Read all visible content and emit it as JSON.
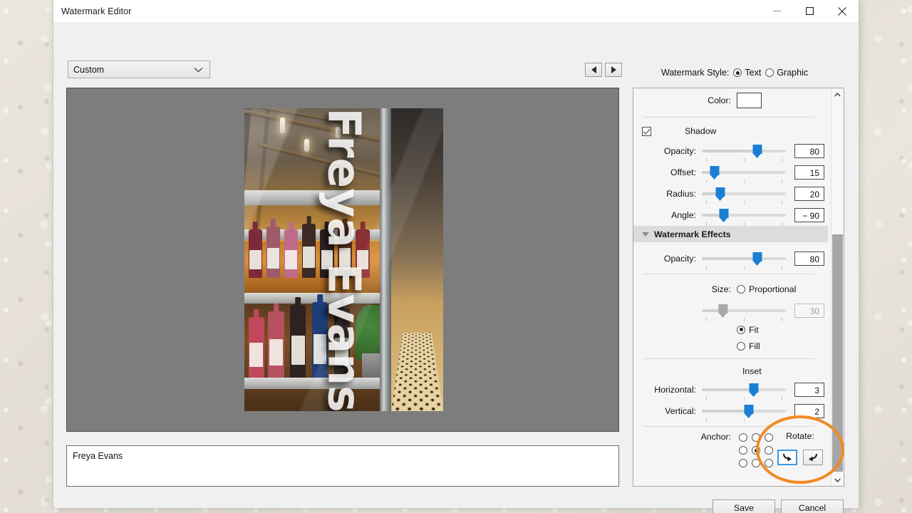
{
  "window": {
    "title": "Watermark Editor",
    "controls": {
      "minimize": "minimize-icon",
      "maximize": "maximize-icon",
      "close": "close-icon"
    }
  },
  "toolbar": {
    "preset_value": "Custom",
    "prev_label": "previous-watermark",
    "next_label": "next-watermark"
  },
  "watermark_style": {
    "label": "Watermark Style:",
    "options": [
      "Text",
      "Graphic"
    ],
    "selected": "Text"
  },
  "preview": {
    "watermark_text": "Freya Evans",
    "backdrop_color": "#7d7d7d"
  },
  "text_input": {
    "value": "Freya Evans"
  },
  "panel": {
    "color": {
      "label": "Color:",
      "value": "#ffffff"
    },
    "shadow": {
      "label": "Shadow",
      "checked": true,
      "opacity": {
        "label": "Opacity:",
        "value": "80"
      },
      "offset": {
        "label": "Offset:",
        "value": "15"
      },
      "radius": {
        "label": "Radius:",
        "value": "20"
      },
      "angle": {
        "label": "Angle:",
        "value": "− 90"
      }
    },
    "effects": {
      "header": "Watermark Effects",
      "opacity": {
        "label": "Opacity:",
        "value": "80"
      },
      "size": {
        "label": "Size:",
        "proportional_label": "Proportional",
        "proportional_selected": false,
        "proportional_value": "30",
        "fit_label": "Fit",
        "fill_label": "Fill",
        "selected": "Fit"
      },
      "inset": {
        "title": "Inset",
        "horizontal": {
          "label": "Horizontal:",
          "value": "3"
        },
        "vertical": {
          "label": "Vertical:",
          "value": "2"
        }
      },
      "anchor": {
        "label": "Anchor:",
        "selected_index": 4
      },
      "rotate": {
        "label": "Rotate:",
        "buttons": [
          "rotate-clockwise-icon",
          "rotate-counterclockwise-icon"
        ],
        "focused_index": 0
      }
    }
  },
  "footer": {
    "save_label": "Save",
    "cancel_label": "Cancel"
  },
  "annotation": {
    "color": "#f08a26",
    "target": "rotate-buttons"
  }
}
